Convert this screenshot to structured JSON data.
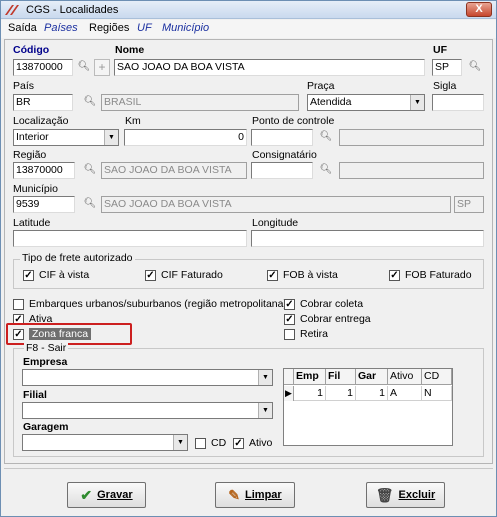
{
  "window": {
    "title": "CGS - Localidades",
    "close_label": "X"
  },
  "menu": [
    "Saída",
    "Países",
    "Regiões",
    "UF",
    "Município"
  ],
  "form": {
    "codigo": {
      "label": "Código",
      "value": "13870000"
    },
    "nome": {
      "label": "Nome",
      "value": "SAO JOAO DA BOA VISTA"
    },
    "uf": {
      "label": "UF",
      "value": "SP"
    },
    "pais": {
      "label": "País",
      "code": "BR",
      "name": "BRASIL"
    },
    "praca": {
      "label": "Praça",
      "value": "Atendida"
    },
    "sigla": {
      "label": "Sigla",
      "value": ""
    },
    "localizacao": {
      "label": "Localização",
      "value": "Interior"
    },
    "km": {
      "label": "Km",
      "value": "0"
    },
    "ponto_controle": {
      "label": "Ponto de controle",
      "value": ""
    },
    "regiao": {
      "label": "Região",
      "code": "13870000",
      "name": "SAO JOAO DA BOA VISTA"
    },
    "consignatario": {
      "label": "Consignatário",
      "value": ""
    },
    "municipio": {
      "label": "Município",
      "code": "9539",
      "name": "SAO JOAO DA BOA VISTA",
      "uf": "SP"
    },
    "latitude": {
      "label": "Latitude",
      "value": ""
    },
    "longitude": {
      "label": "Longitude",
      "value": ""
    }
  },
  "frete": {
    "title": "Tipo de frete autorizado",
    "options": [
      {
        "label": "CIF à vista",
        "checked": true
      },
      {
        "label": "CIF Faturado",
        "checked": true
      },
      {
        "label": "FOB à vista",
        "checked": true
      },
      {
        "label": "FOB Faturado",
        "checked": true
      }
    ]
  },
  "flags_left": [
    {
      "label": "Embarques urbanos/suburbanos (região metropolitana)",
      "checked": false
    },
    {
      "label": "Ativa",
      "checked": true
    },
    {
      "label": "Zona franca",
      "checked": true
    }
  ],
  "flags_right": [
    {
      "label": "Cobrar coleta",
      "checked": true
    },
    {
      "label": "Cobrar entrega",
      "checked": true
    },
    {
      "label": "Retira",
      "checked": false
    }
  ],
  "f8": {
    "title": "F8 - Sair",
    "empresa_label": "Empresa",
    "filial_label": "Filial",
    "garagem_label": "Garagem",
    "cd_label": "CD",
    "cd_checked": false,
    "ativo_label": "Ativo",
    "ativo_checked": true
  },
  "grid": {
    "columns": [
      "Emp",
      "Fil",
      "Gar",
      "Ativo",
      "CD"
    ],
    "rows": [
      {
        "emp": "1",
        "fil": "1",
        "gar": "1",
        "ativo": "A",
        "cd": "N"
      }
    ]
  },
  "buttons": {
    "gravar": "Gravar",
    "limpar": "Limpar",
    "excluir": "Excluir"
  },
  "colors": {
    "highlight": "#cc1f1f",
    "accent_blue": "#1a2fa0"
  }
}
